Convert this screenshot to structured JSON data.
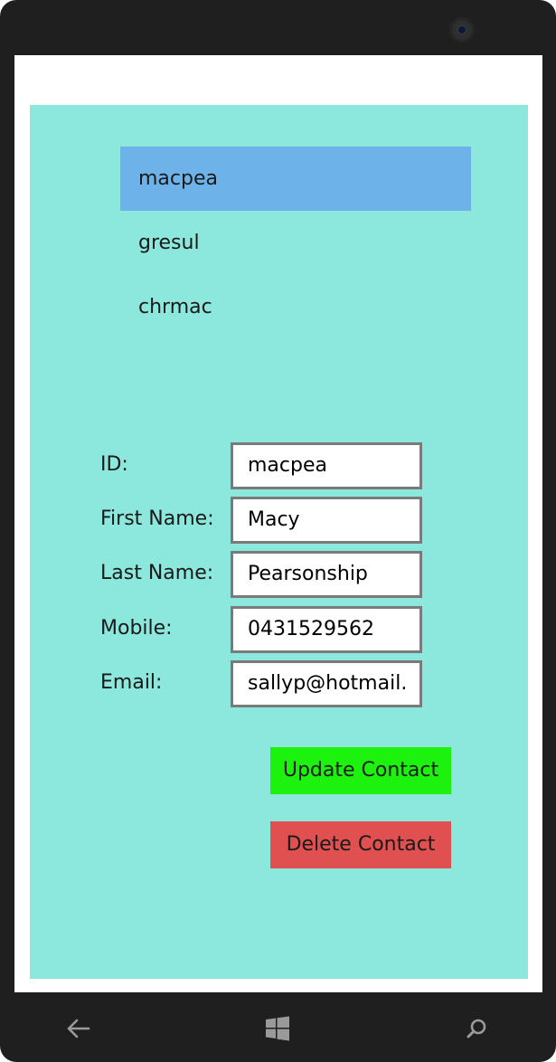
{
  "contacts": [
    {
      "label": "macpea",
      "selected": true
    },
    {
      "label": "gresul",
      "selected": false
    },
    {
      "label": "chrmac",
      "selected": false
    }
  ],
  "form": {
    "id_label": "ID:",
    "id_value": "macpea",
    "first_name_label": "First Name:",
    "first_name_value": "Macy",
    "last_name_label": "Last Name:",
    "last_name_value": "Pearsonship",
    "mobile_label": "Mobile:",
    "mobile_value": "0431529562",
    "email_label": "Email:",
    "email_value": "sallyp@hotmail."
  },
  "buttons": {
    "update_label": "Update Contact",
    "delete_label": "Delete Contact"
  },
  "colors": {
    "app_background": "#8ce7dc",
    "selected_item": "#6db3e9",
    "update_button": "#1cf20e",
    "delete_button": "#e05050",
    "phone_frame": "#1f1f1f"
  },
  "nav_icons": [
    "back-arrow-icon",
    "windows-start-icon",
    "search-icon"
  ]
}
